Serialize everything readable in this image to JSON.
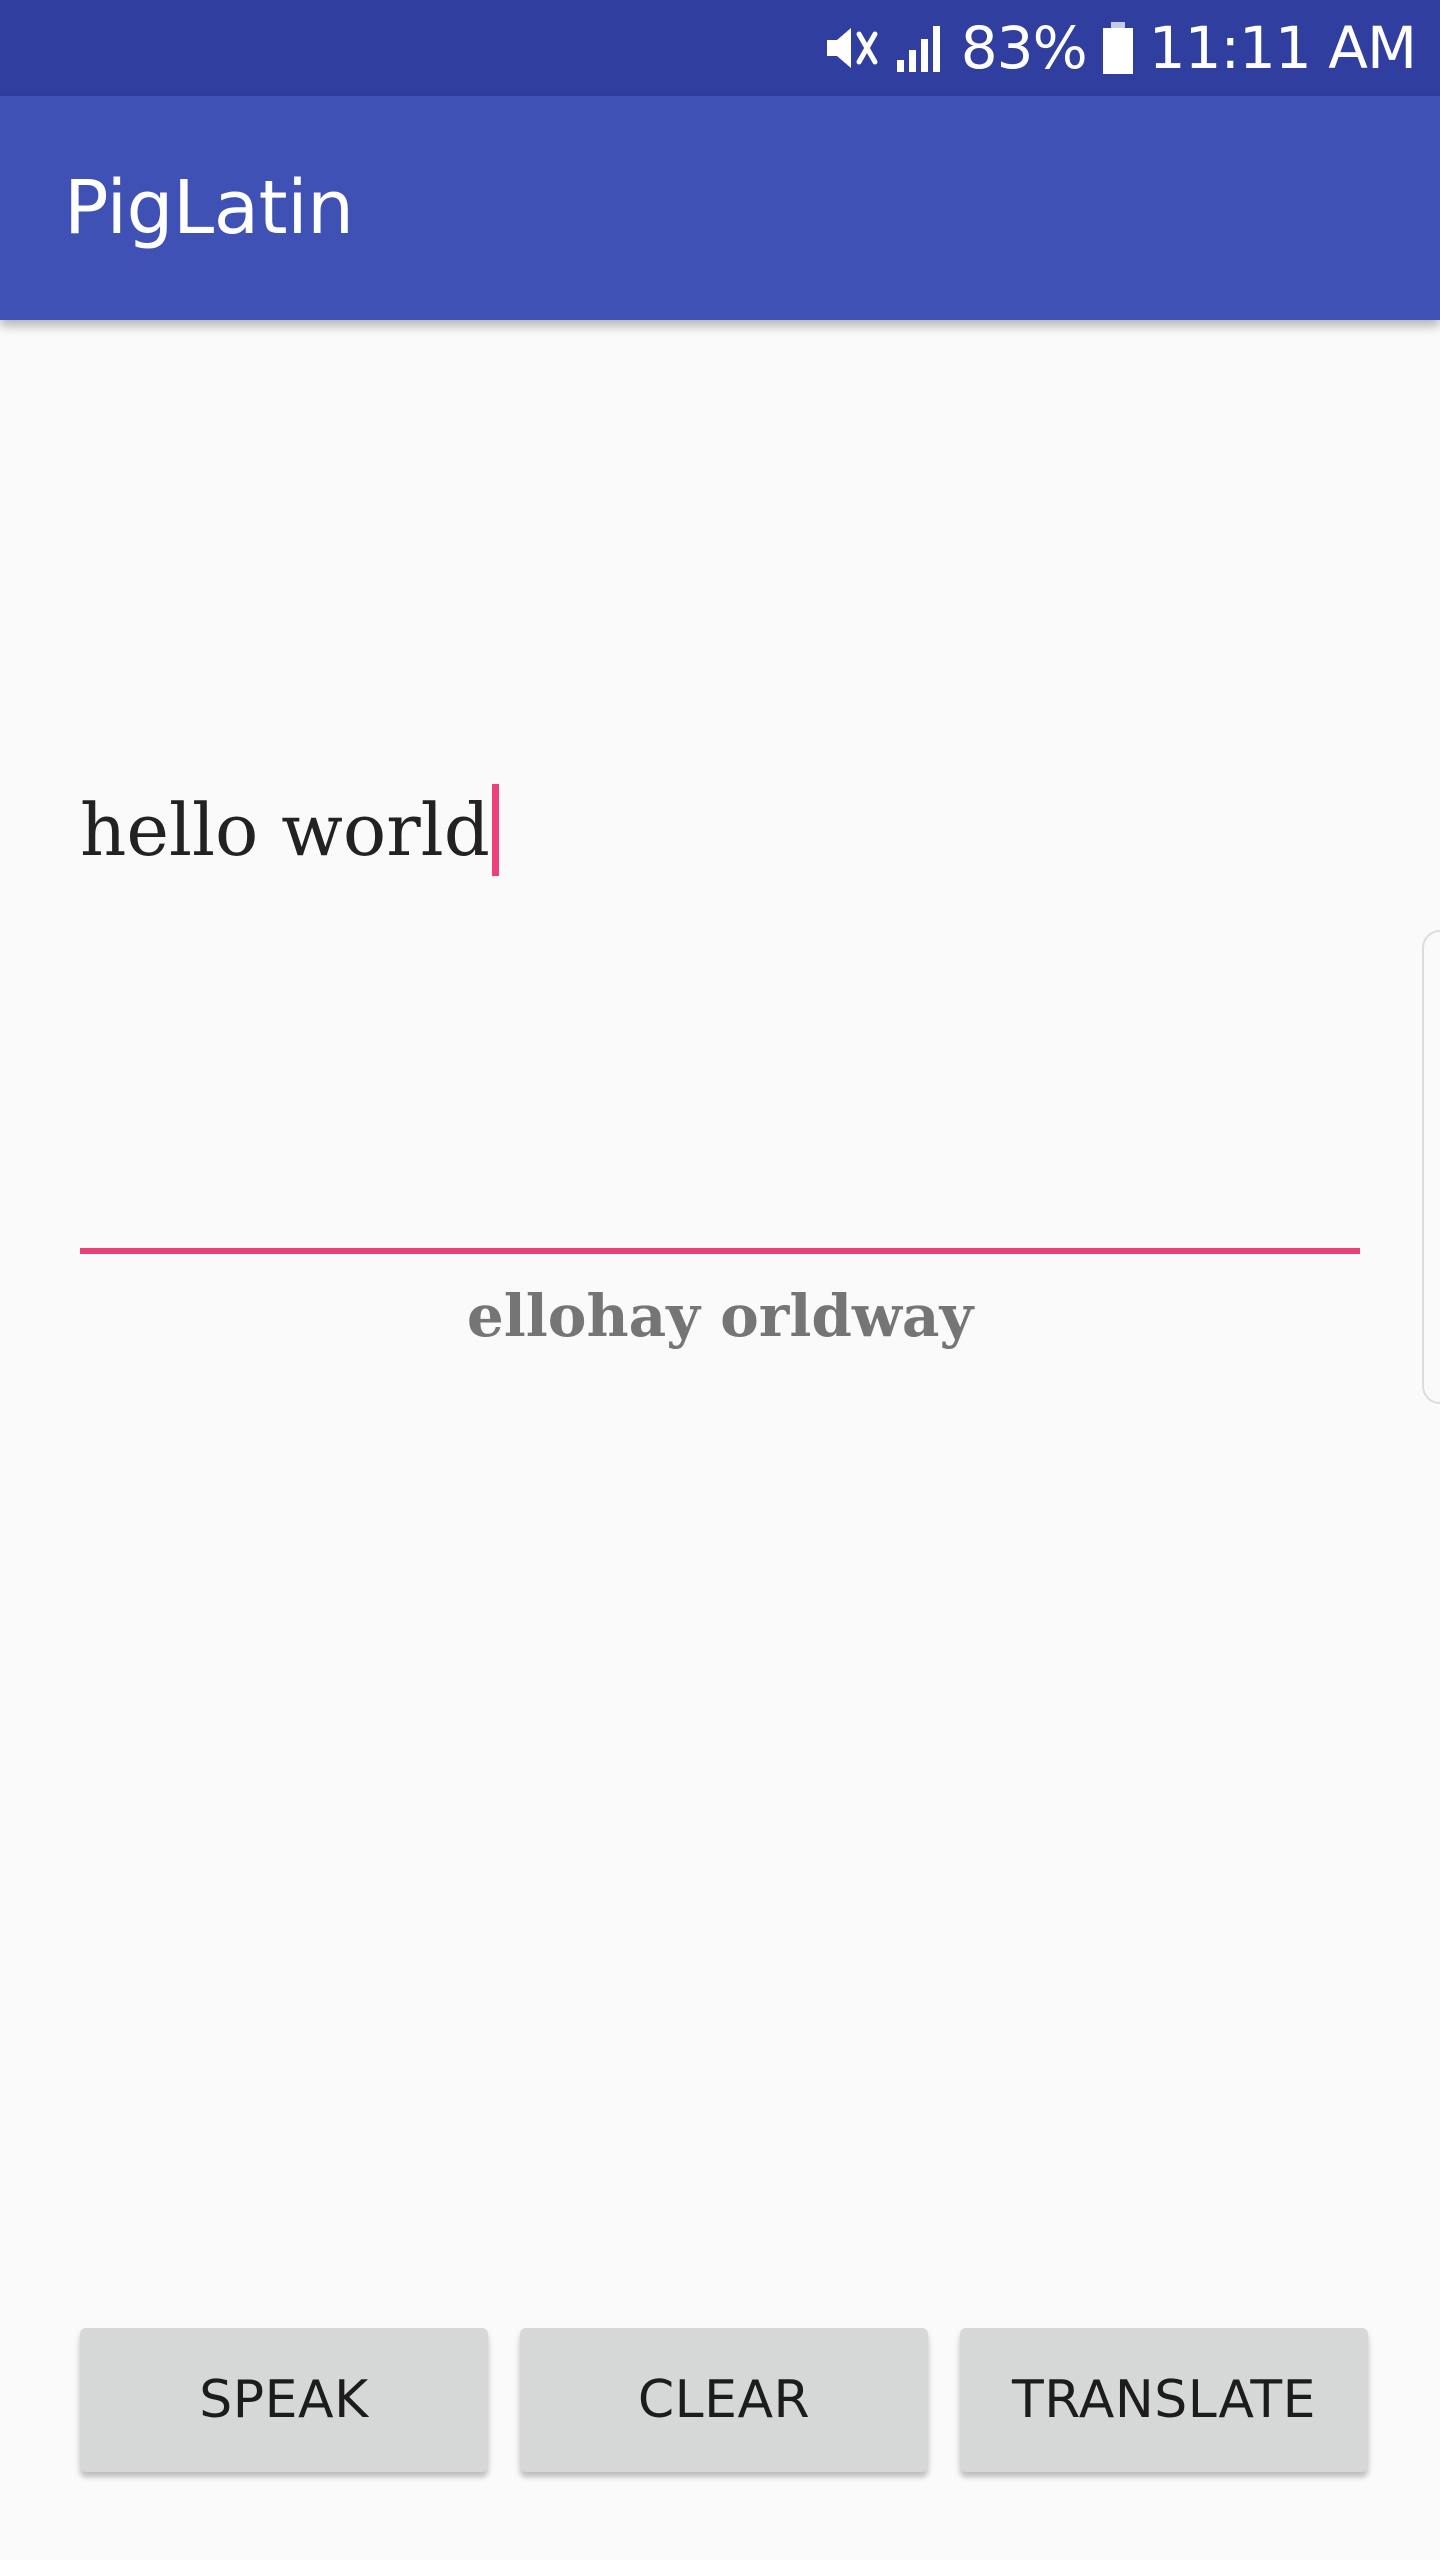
{
  "status_bar": {
    "icons": [
      "vibrate-mute-icon",
      "signal-icon",
      "battery-icon"
    ],
    "battery_percent": "83%",
    "time": "11:11 AM"
  },
  "app_bar": {
    "title": "PigLatin"
  },
  "input": {
    "value": "hello world"
  },
  "output": {
    "text": "ellohay orldway"
  },
  "buttons": {
    "speak": "SPEAK",
    "clear": "CLEAR",
    "translate": "TRANSLATE"
  },
  "colors": {
    "status_bar": "#303f9f",
    "primary": "#3f51b5",
    "accent": "#ec407a",
    "background": "#fafafa",
    "button": "#d6d7d7"
  }
}
